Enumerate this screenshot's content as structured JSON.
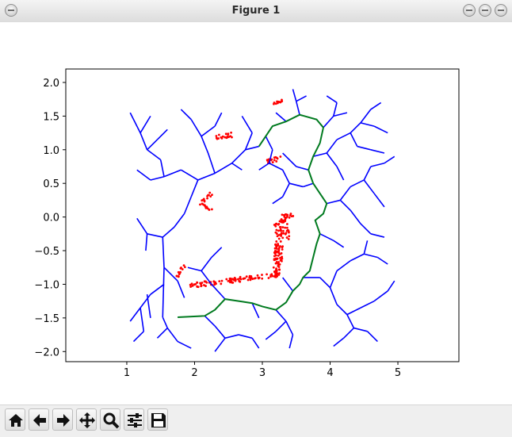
{
  "window": {
    "title": "Figure 1"
  },
  "toolbar": {
    "buttons": [
      {
        "name": "home-button",
        "icon": "home-icon"
      },
      {
        "name": "back-button",
        "icon": "arrow-left-icon"
      },
      {
        "name": "forward-button",
        "icon": "arrow-right-icon"
      },
      {
        "name": "pan-button",
        "icon": "move-icon"
      },
      {
        "name": "zoom-button",
        "icon": "zoom-icon"
      },
      {
        "name": "configure-subplots-button",
        "icon": "sliders-icon"
      },
      {
        "name": "save-button",
        "icon": "save-icon"
      }
    ]
  },
  "chart_data": {
    "type": "line",
    "xlim": [
      0.1,
      5.9
    ],
    "ylim": [
      -2.15,
      2.2
    ],
    "xticks": [
      "1",
      "2",
      "3",
      "4",
      "5"
    ],
    "yticks": [
      "2.0",
      "1.5",
      "1.0",
      "0.5",
      "0.0",
      "−0.5",
      "−1.0",
      "−1.5",
      "−2.0"
    ],
    "xtick_values": [
      1,
      2,
      3,
      4,
      5
    ],
    "ytick_values": [
      2.0,
      1.5,
      1.0,
      0.5,
      0.0,
      -0.5,
      -1.0,
      -1.5,
      -2.0
    ],
    "colors": {
      "tree": "#0000ff",
      "path": "#007a1f",
      "obstacle": "#ff0000"
    },
    "path": [
      [
        1.75,
        -1.49
      ],
      [
        2.15,
        -1.47
      ],
      [
        2.3,
        -1.38
      ],
      [
        2.45,
        -1.22
      ],
      [
        2.65,
        -1.25
      ],
      [
        2.85,
        -1.28
      ],
      [
        3.0,
        -1.33
      ],
      [
        3.2,
        -1.38
      ],
      [
        3.35,
        -1.27
      ],
      [
        3.45,
        -1.1
      ],
      [
        3.55,
        -1.0
      ],
      [
        3.6,
        -0.9
      ],
      [
        3.7,
        -0.8
      ],
      [
        3.75,
        -0.6
      ],
      [
        3.8,
        -0.4
      ],
      [
        3.85,
        -0.25
      ],
      [
        3.78,
        -0.05
      ],
      [
        3.9,
        0.05
      ],
      [
        3.95,
        0.2
      ],
      [
        3.85,
        0.35
      ],
      [
        3.75,
        0.5
      ],
      [
        3.68,
        0.7
      ],
      [
        3.75,
        0.9
      ],
      [
        3.85,
        1.1
      ],
      [
        3.9,
        1.33
      ],
      [
        3.8,
        1.45
      ],
      [
        3.55,
        1.52
      ],
      [
        3.35,
        1.42
      ],
      [
        3.15,
        1.35
      ],
      [
        3.05,
        1.2
      ],
      [
        2.95,
        1.05
      ]
    ],
    "tree_segments": [
      [
        [
          1.53,
          -1.49
        ],
        [
          1.55,
          -0.75
        ]
      ],
      [
        [
          1.55,
          -0.75
        ],
        [
          1.53,
          -0.3
        ]
      ],
      [
        [
          1.53,
          -0.3
        ],
        [
          1.3,
          -0.25
        ]
      ],
      [
        [
          1.3,
          -0.25
        ],
        [
          1.15,
          -0.02
        ]
      ],
      [
        [
          1.3,
          -0.25
        ],
        [
          1.28,
          -0.5
        ]
      ],
      [
        [
          1.53,
          -0.3
        ],
        [
          1.7,
          -0.15
        ]
      ],
      [
        [
          1.7,
          -0.15
        ],
        [
          1.85,
          0.05
        ]
      ],
      [
        [
          1.85,
          0.05
        ],
        [
          1.95,
          0.3
        ]
      ],
      [
        [
          1.95,
          0.3
        ],
        [
          2.05,
          0.55
        ]
      ],
      [
        [
          2.05,
          0.55
        ],
        [
          1.8,
          0.7
        ]
      ],
      [
        [
          2.05,
          0.55
        ],
        [
          2.3,
          0.65
        ]
      ],
      [
        [
          2.3,
          0.65
        ],
        [
          2.55,
          0.8
        ]
      ],
      [
        [
          2.55,
          0.8
        ],
        [
          2.7,
          0.7
        ]
      ],
      [
        [
          2.3,
          0.65
        ],
        [
          2.2,
          0.95
        ]
      ],
      [
        [
          2.2,
          0.95
        ],
        [
          2.1,
          1.2
        ]
      ],
      [
        [
          1.8,
          0.7
        ],
        [
          1.55,
          0.6
        ]
      ],
      [
        [
          1.55,
          0.6
        ],
        [
          1.35,
          0.55
        ]
      ],
      [
        [
          1.35,
          0.55
        ],
        [
          1.15,
          0.7
        ]
      ],
      [
        [
          1.55,
          0.6
        ],
        [
          1.5,
          0.85
        ]
      ],
      [
        [
          1.5,
          0.85
        ],
        [
          1.3,
          1.0
        ]
      ],
      [
        [
          1.3,
          1.0
        ],
        [
          1.2,
          1.25
        ]
      ],
      [
        [
          1.2,
          1.25
        ],
        [
          1.05,
          1.55
        ]
      ],
      [
        [
          1.3,
          1.0
        ],
        [
          1.45,
          1.15
        ]
      ],
      [
        [
          1.45,
          1.15
        ],
        [
          1.6,
          1.3
        ]
      ],
      [
        [
          1.2,
          1.25
        ],
        [
          1.35,
          1.5
        ]
      ],
      [
        [
          2.1,
          1.2
        ],
        [
          1.95,
          1.45
        ]
      ],
      [
        [
          1.95,
          1.45
        ],
        [
          1.8,
          1.6
        ]
      ],
      [
        [
          2.1,
          1.2
        ],
        [
          2.3,
          1.35
        ]
      ],
      [
        [
          2.3,
          1.35
        ],
        [
          2.4,
          1.55
        ]
      ],
      [
        [
          2.55,
          0.8
        ],
        [
          2.75,
          1.0
        ]
      ],
      [
        [
          2.75,
          1.0
        ],
        [
          2.85,
          1.25
        ]
      ],
      [
        [
          2.85,
          1.25
        ],
        [
          2.7,
          1.5
        ]
      ],
      [
        [
          1.55,
          -0.75
        ],
        [
          1.75,
          -0.95
        ]
      ],
      [
        [
          1.75,
          -0.95
        ],
        [
          1.85,
          -1.2
        ]
      ],
      [
        [
          1.55,
          -1.0
        ],
        [
          1.35,
          -1.15
        ]
      ],
      [
        [
          1.35,
          -1.15
        ],
        [
          1.2,
          -1.35
        ]
      ],
      [
        [
          1.2,
          -1.35
        ],
        [
          1.05,
          -1.55
        ]
      ],
      [
        [
          1.2,
          -1.35
        ],
        [
          1.25,
          -1.7
        ]
      ],
      [
        [
          1.25,
          -1.7
        ],
        [
          1.1,
          -1.85
        ]
      ],
      [
        [
          1.53,
          -1.49
        ],
        [
          1.6,
          -1.65
        ]
      ],
      [
        [
          1.6,
          -1.65
        ],
        [
          1.75,
          -1.85
        ]
      ],
      [
        [
          1.75,
          -1.85
        ],
        [
          1.95,
          -1.95
        ]
      ],
      [
        [
          1.6,
          -1.65
        ],
        [
          1.45,
          -1.8
        ]
      ],
      [
        [
          2.15,
          -1.47
        ],
        [
          2.3,
          -1.62
        ]
      ],
      [
        [
          2.3,
          -1.62
        ],
        [
          2.45,
          -1.8
        ]
      ],
      [
        [
          2.45,
          -1.8
        ],
        [
          2.3,
          -2.0
        ]
      ],
      [
        [
          2.45,
          -1.8
        ],
        [
          2.65,
          -1.75
        ]
      ],
      [
        [
          2.65,
          -1.75
        ],
        [
          2.85,
          -1.8
        ]
      ],
      [
        [
          2.85,
          -1.8
        ],
        [
          2.95,
          -1.95
        ]
      ],
      [
        [
          3.2,
          -1.38
        ],
        [
          3.35,
          -1.55
        ]
      ],
      [
        [
          3.35,
          -1.55
        ],
        [
          3.45,
          -1.75
        ]
      ],
      [
        [
          3.45,
          -1.75
        ],
        [
          3.4,
          -1.95
        ]
      ],
      [
        [
          3.35,
          -1.55
        ],
        [
          3.2,
          -1.7
        ]
      ],
      [
        [
          3.2,
          -1.7
        ],
        [
          3.05,
          -1.82
        ]
      ],
      [
        [
          2.85,
          -1.28
        ],
        [
          2.95,
          -1.5
        ]
      ],
      [
        [
          2.45,
          -1.22
        ],
        [
          2.25,
          -1.0
        ]
      ],
      [
        [
          2.25,
          -1.0
        ],
        [
          2.1,
          -0.8
        ]
      ],
      [
        [
          2.1,
          -0.8
        ],
        [
          2.25,
          -0.6
        ]
      ],
      [
        [
          2.25,
          -0.6
        ],
        [
          2.4,
          -0.45
        ]
      ],
      [
        [
          2.1,
          -0.8
        ],
        [
          1.9,
          -0.75
        ]
      ],
      [
        [
          3.45,
          -1.1
        ],
        [
          3.3,
          -0.9
        ]
      ],
      [
        [
          3.6,
          -0.9
        ],
        [
          3.85,
          -0.9
        ]
      ],
      [
        [
          3.85,
          -0.9
        ],
        [
          4.0,
          -1.05
        ]
      ],
      [
        [
          4.0,
          -1.05
        ],
        [
          4.1,
          -1.3
        ]
      ],
      [
        [
          4.1,
          -1.3
        ],
        [
          4.25,
          -1.45
        ]
      ],
      [
        [
          4.25,
          -1.45
        ],
        [
          4.35,
          -1.65
        ]
      ],
      [
        [
          4.35,
          -1.65
        ],
        [
          4.2,
          -1.8
        ]
      ],
      [
        [
          4.2,
          -1.8
        ],
        [
          4.05,
          -1.92
        ]
      ],
      [
        [
          4.35,
          -1.65
        ],
        [
          4.55,
          -1.7
        ]
      ],
      [
        [
          4.55,
          -1.7
        ],
        [
          4.7,
          -1.85
        ]
      ],
      [
        [
          4.25,
          -1.45
        ],
        [
          4.45,
          -1.35
        ]
      ],
      [
        [
          4.45,
          -1.35
        ],
        [
          4.65,
          -1.25
        ]
      ],
      [
        [
          4.65,
          -1.25
        ],
        [
          4.85,
          -1.1
        ]
      ],
      [
        [
          4.85,
          -1.1
        ],
        [
          4.95,
          -0.95
        ]
      ],
      [
        [
          4.0,
          -1.05
        ],
        [
          4.1,
          -0.8
        ]
      ],
      [
        [
          4.1,
          -0.8
        ],
        [
          4.3,
          -0.65
        ]
      ],
      [
        [
          4.3,
          -0.65
        ],
        [
          4.5,
          -0.55
        ]
      ],
      [
        [
          4.5,
          -0.55
        ],
        [
          4.7,
          -0.6
        ]
      ],
      [
        [
          4.7,
          -0.6
        ],
        [
          4.85,
          -0.7
        ]
      ],
      [
        [
          4.5,
          -0.55
        ],
        [
          4.55,
          -0.35
        ]
      ],
      [
        [
          3.85,
          -0.25
        ],
        [
          4.05,
          -0.35
        ]
      ],
      [
        [
          4.05,
          -0.35
        ],
        [
          4.2,
          -0.45
        ]
      ],
      [
        [
          3.95,
          0.2
        ],
        [
          4.15,
          0.25
        ]
      ],
      [
        [
          4.15,
          0.25
        ],
        [
          4.3,
          0.1
        ]
      ],
      [
        [
          4.3,
          0.1
        ],
        [
          4.45,
          -0.1
        ]
      ],
      [
        [
          4.45,
          -0.1
        ],
        [
          4.6,
          -0.25
        ]
      ],
      [
        [
          4.6,
          -0.25
        ],
        [
          4.8,
          -0.3
        ]
      ],
      [
        [
          4.15,
          0.25
        ],
        [
          4.3,
          0.45
        ]
      ],
      [
        [
          4.3,
          0.45
        ],
        [
          4.5,
          0.55
        ]
      ],
      [
        [
          4.5,
          0.55
        ],
        [
          4.65,
          0.35
        ]
      ],
      [
        [
          4.65,
          0.35
        ],
        [
          4.8,
          0.15
        ]
      ],
      [
        [
          4.5,
          0.55
        ],
        [
          4.6,
          0.75
        ]
      ],
      [
        [
          4.6,
          0.75
        ],
        [
          4.8,
          0.8
        ]
      ],
      [
        [
          4.8,
          0.8
        ],
        [
          4.95,
          0.9
        ]
      ],
      [
        [
          3.75,
          0.9
        ],
        [
          3.95,
          0.95
        ]
      ],
      [
        [
          3.95,
          0.95
        ],
        [
          4.1,
          0.75
        ]
      ],
      [
        [
          4.1,
          0.75
        ],
        [
          4.2,
          0.55
        ]
      ],
      [
        [
          3.95,
          0.95
        ],
        [
          4.1,
          1.15
        ]
      ],
      [
        [
          4.1,
          1.15
        ],
        [
          4.3,
          1.25
        ]
      ],
      [
        [
          4.3,
          1.25
        ],
        [
          4.45,
          1.4
        ]
      ],
      [
        [
          4.45,
          1.4
        ],
        [
          4.6,
          1.6
        ]
      ],
      [
        [
          4.6,
          1.6
        ],
        [
          4.75,
          1.7
        ]
      ],
      [
        [
          4.45,
          1.4
        ],
        [
          4.65,
          1.35
        ]
      ],
      [
        [
          4.65,
          1.35
        ],
        [
          4.85,
          1.25
        ]
      ],
      [
        [
          4.3,
          1.25
        ],
        [
          4.4,
          1.05
        ]
      ],
      [
        [
          4.4,
          1.05
        ],
        [
          4.6,
          1.0
        ]
      ],
      [
        [
          4.6,
          1.0
        ],
        [
          4.8,
          0.95
        ]
      ],
      [
        [
          3.9,
          1.33
        ],
        [
          4.05,
          1.5
        ]
      ],
      [
        [
          4.05,
          1.5
        ],
        [
          4.1,
          1.7
        ]
      ],
      [
        [
          4.1,
          1.7
        ],
        [
          3.95,
          1.8
        ]
      ],
      [
        [
          4.05,
          1.5
        ],
        [
          4.25,
          1.55
        ]
      ],
      [
        [
          3.55,
          1.52
        ],
        [
          3.5,
          1.72
        ]
      ],
      [
        [
          3.5,
          1.72
        ],
        [
          3.45,
          1.9
        ]
      ],
      [
        [
          3.5,
          1.72
        ],
        [
          3.65,
          1.8
        ]
      ],
      [
        [
          3.35,
          1.42
        ],
        [
          3.2,
          1.55
        ]
      ],
      [
        [
          3.05,
          1.2
        ],
        [
          3.15,
          1.0
        ]
      ],
      [
        [
          3.15,
          1.0
        ],
        [
          3.1,
          0.8
        ]
      ],
      [
        [
          3.1,
          0.8
        ],
        [
          2.95,
          0.7
        ]
      ],
      [
        [
          3.1,
          0.8
        ],
        [
          3.3,
          0.7
        ]
      ],
      [
        [
          3.3,
          0.7
        ],
        [
          3.4,
          0.5
        ]
      ],
      [
        [
          3.4,
          0.5
        ],
        [
          3.3,
          0.3
        ]
      ],
      [
        [
          3.3,
          0.3
        ],
        [
          3.15,
          0.2
        ]
      ],
      [
        [
          3.4,
          0.5
        ],
        [
          3.6,
          0.45
        ]
      ],
      [
        [
          3.6,
          0.45
        ],
        [
          3.75,
          0.5
        ]
      ],
      [
        [
          2.95,
          1.05
        ],
        [
          2.75,
          1.0
        ]
      ],
      [
        [
          1.3,
          -1.15
        ],
        [
          1.35,
          -1.5
        ]
      ],
      [
        [
          3.68,
          0.7
        ],
        [
          3.5,
          0.75
        ]
      ],
      [
        [
          3.5,
          0.75
        ],
        [
          3.3,
          0.95
        ]
      ]
    ],
    "obstacles": [
      {
        "type": "band",
        "from": [
          1.93,
          -1.02
        ],
        "to": [
          3.28,
          -0.85
        ],
        "width": 0.07
      },
      {
        "type": "band",
        "from": [
          3.22,
          -0.88
        ],
        "to": [
          3.26,
          -0.12
        ],
        "width": 0.12
      },
      {
        "type": "band",
        "from": [
          3.18,
          -0.12
        ],
        "to": [
          3.45,
          0.04
        ],
        "width": 0.08
      },
      {
        "type": "band",
        "from": [
          3.32,
          0.04
        ],
        "to": [
          3.38,
          -0.35
        ],
        "width": 0.06
      },
      {
        "type": "band",
        "from": [
          2.08,
          0.2
        ],
        "to": [
          2.25,
          0.35
        ],
        "width": 0.05
      },
      {
        "type": "band",
        "from": [
          2.08,
          0.2
        ],
        "to": [
          2.25,
          0.1
        ],
        "width": 0.04
      },
      {
        "type": "band",
        "from": [
          1.75,
          -0.9
        ],
        "to": [
          1.85,
          -0.7
        ],
        "width": 0.06
      },
      {
        "type": "band",
        "from": [
          2.3,
          1.18
        ],
        "to": [
          2.55,
          1.22
        ],
        "width": 0.07
      },
      {
        "type": "band",
        "from": [
          3.05,
          0.82
        ],
        "to": [
          3.28,
          0.87
        ],
        "width": 0.07
      },
      {
        "type": "band",
        "from": [
          3.15,
          1.68
        ],
        "to": [
          3.32,
          1.74
        ],
        "width": 0.03
      }
    ]
  }
}
